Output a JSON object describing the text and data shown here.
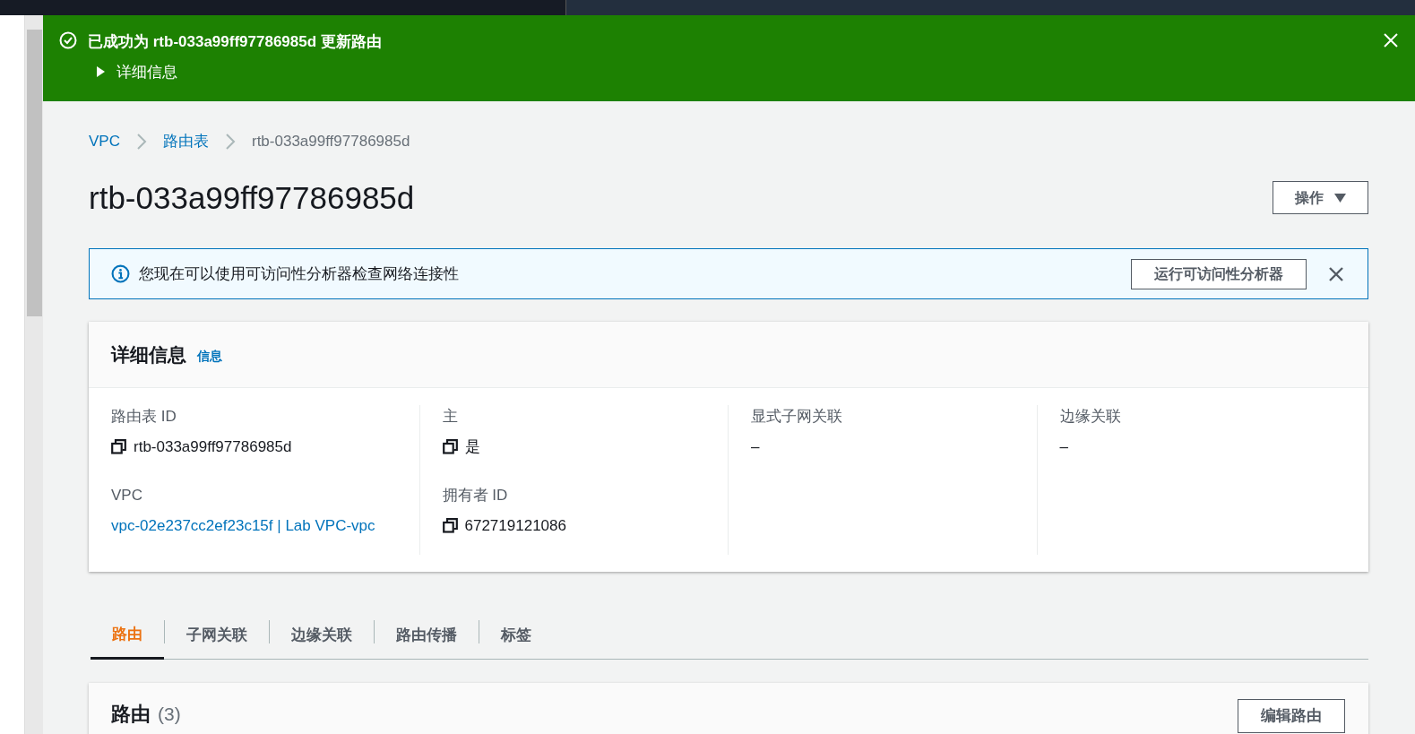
{
  "flash": {
    "message": "已成功为 rtb-033a99ff97786985d 更新路由",
    "details_label": "详细信息",
    "details_expanded": false
  },
  "breadcrumbs": [
    {
      "label": "VPC",
      "link": true
    },
    {
      "label": "路由表",
      "link": true
    },
    {
      "label": "rtb-033a99ff97786985d",
      "link": false
    }
  ],
  "page_title": "rtb-033a99ff97786985d",
  "actions_button": "操作",
  "info_alert": {
    "message": "您现在可以使用可访问性分析器检查网络连接性",
    "button": "运行可访问性分析器"
  },
  "details": {
    "title": "详细信息",
    "info_link": "信息",
    "columns": [
      [
        {
          "label": "路由表 ID",
          "value": "rtb-033a99ff97786985d",
          "copy": true,
          "link": false
        },
        {
          "label": "VPC",
          "value": "vpc-02e237cc2ef23c15f | Lab VPC-vpc",
          "copy": false,
          "link": true
        }
      ],
      [
        {
          "label": "主",
          "value": "是",
          "copy": true,
          "link": false
        },
        {
          "label": "拥有者 ID",
          "value": "672719121086",
          "copy": true,
          "link": false
        }
      ],
      [
        {
          "label": "显式子网关联",
          "value": "–",
          "copy": false,
          "link": false
        }
      ],
      [
        {
          "label": "边缘关联",
          "value": "–",
          "copy": false,
          "link": false
        }
      ]
    ]
  },
  "tabs": [
    {
      "label": "路由",
      "selected": true
    },
    {
      "label": "子网关联",
      "selected": false
    },
    {
      "label": "边缘关联",
      "selected": false
    },
    {
      "label": "路由传播",
      "selected": false
    },
    {
      "label": "标签",
      "selected": false
    }
  ],
  "routes_panel": {
    "title": "路由",
    "count": "(3)",
    "edit_button": "编辑路由"
  }
}
